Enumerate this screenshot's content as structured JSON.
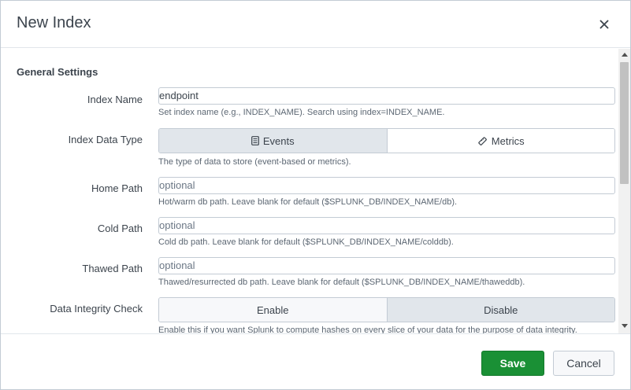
{
  "modal": {
    "title": "New Index",
    "close_icon": "close-icon"
  },
  "general": {
    "section_title": "General Settings",
    "index_name": {
      "label": "Index Name",
      "value": "endpoint",
      "help": "Set index name (e.g., INDEX_NAME). Search using index=INDEX_NAME."
    },
    "data_type": {
      "label": "Index Data Type",
      "options": [
        "Events",
        "Metrics"
      ],
      "icons": [
        "document-icon",
        "ruler-icon"
      ],
      "selected": "Events",
      "help": "The type of data to store (event-based or metrics)."
    },
    "home_path": {
      "label": "Home Path",
      "placeholder": "optional",
      "help": "Hot/warm db path. Leave blank for default ($SPLUNK_DB/INDEX_NAME/db)."
    },
    "cold_path": {
      "label": "Cold Path",
      "placeholder": "optional",
      "help": "Cold db path. Leave blank for default ($SPLUNK_DB/INDEX_NAME/colddb)."
    },
    "thawed_path": {
      "label": "Thawed Path",
      "placeholder": "optional",
      "help": "Thawed/resurrected db path. Leave blank for default ($SPLUNK_DB/INDEX_NAME/thaweddb)."
    },
    "integrity": {
      "label": "Data Integrity Check",
      "options": [
        "Enable",
        "Disable"
      ],
      "selected": "Disable",
      "help": "Enable this if you want Splunk to compute hashes on every slice of your data for the purpose of data integrity."
    }
  },
  "footer": {
    "save_label": "Save",
    "cancel_label": "Cancel"
  },
  "colors": {
    "save_green": "#1a9035",
    "selected_toggle": "#e1e6eb",
    "border": "#c3cbd4"
  }
}
